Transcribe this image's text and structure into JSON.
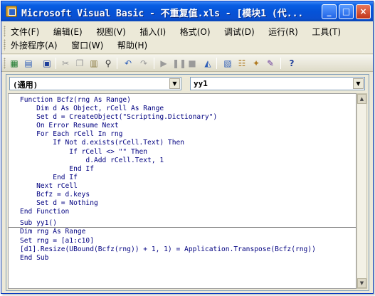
{
  "window": {
    "title": "Microsoft Visual Basic - 不重复值.xls - [模块1 (代...",
    "controls": {
      "minimize": "_",
      "maximize": "□",
      "close": "×"
    }
  },
  "menu": {
    "row1": [
      "文件(F)",
      "编辑(E)",
      "视图(V)",
      "插入(I)",
      "格式(O)",
      "调试(D)",
      "运行(R)",
      "工具(T)"
    ],
    "row2": [
      "外接程序(A)",
      "窗口(W)",
      "帮助(H)"
    ]
  },
  "toolbar_icons": [
    "excel-icon",
    "insert-module-icon",
    "save-icon",
    "cut-icon",
    "copy-icon",
    "paste-icon",
    "find-icon",
    "undo-icon",
    "redo-icon",
    "run-icon",
    "pause-icon",
    "reset-icon",
    "design-mode-icon",
    "project-explorer-icon",
    "properties-icon",
    "object-browser-icon",
    "toolbox-icon",
    "help-icon"
  ],
  "code_window": {
    "object_combo": "(通用)",
    "procedure_combo": "yy1",
    "function_lines": [
      "Function Bcfz(rng As Range)",
      "    Dim d As Object, rCell As Range",
      "    Set d = CreateObject(\"Scripting.Dictionary\")",
      "    On Error Resume Next",
      "    For Each rCell In rng",
      "        If Not d.exists(rCell.Text) Then",
      "            If rCell <> \"\" Then",
      "                d.Add rCell.Text, 1",
      "            End If",
      "        End If",
      "    Next rCell",
      "    Bcfz = d.keys",
      "    Set d = Nothing",
      "End Function"
    ],
    "sub_lines": [
      "Sub yy1()",
      "Dim rng As Range",
      "Set rng = [a1:c10]",
      "[d1].Resize(UBound(Bcfz(rng)) + 1, 1) = Application.Transpose(Bcfz(rng))",
      "End Sub"
    ]
  }
}
